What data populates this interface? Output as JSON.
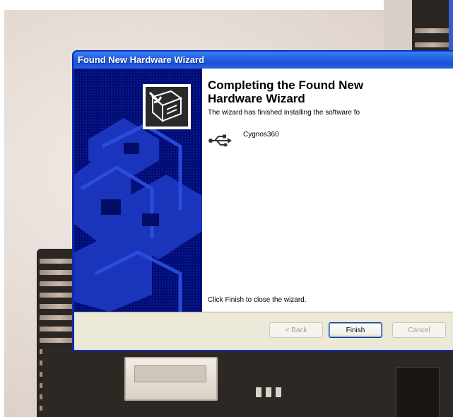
{
  "window": {
    "title": "Found New Hardware Wizard"
  },
  "content": {
    "heading": "Completing the Found New Hardware Wizard",
    "description": "The wizard has finished installing the software fo",
    "device_name": "Cygnos360",
    "device_icon": "usb-icon",
    "close_hint": "Click Finish to close the wizard."
  },
  "buttons": {
    "back": "< Back",
    "finish": "Finish",
    "cancel": "Cancel"
  },
  "colors": {
    "title_bar": "#2461e0",
    "side_panel": "#000d7a",
    "footer": "#ece9d8"
  }
}
